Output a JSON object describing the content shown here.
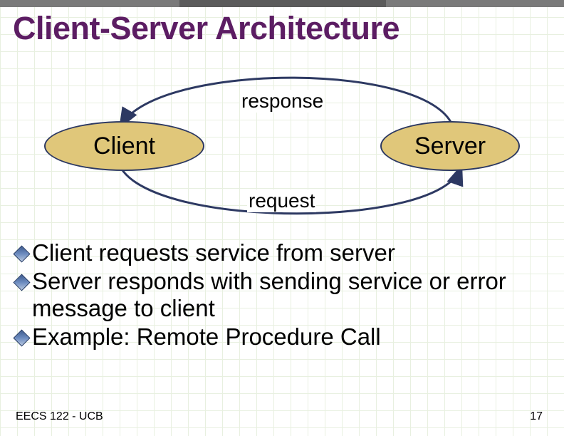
{
  "title": "Client-Server Architecture",
  "diagram": {
    "client_label": "Client",
    "server_label": "Server",
    "top_arrow_label": "response",
    "bottom_arrow_label": "request"
  },
  "bullets": [
    "Client requests service from server",
    "Server responds with sending service or error message to client",
    "Example: Remote Procedure Call"
  ],
  "footer": {
    "course": "EECS 122 - UCB",
    "slide_number": "17"
  },
  "colors": {
    "title_color": "#5c1d63",
    "node_fill": "#e0c77a",
    "node_border": "#2d3962",
    "arc_color": "#2d3962"
  }
}
